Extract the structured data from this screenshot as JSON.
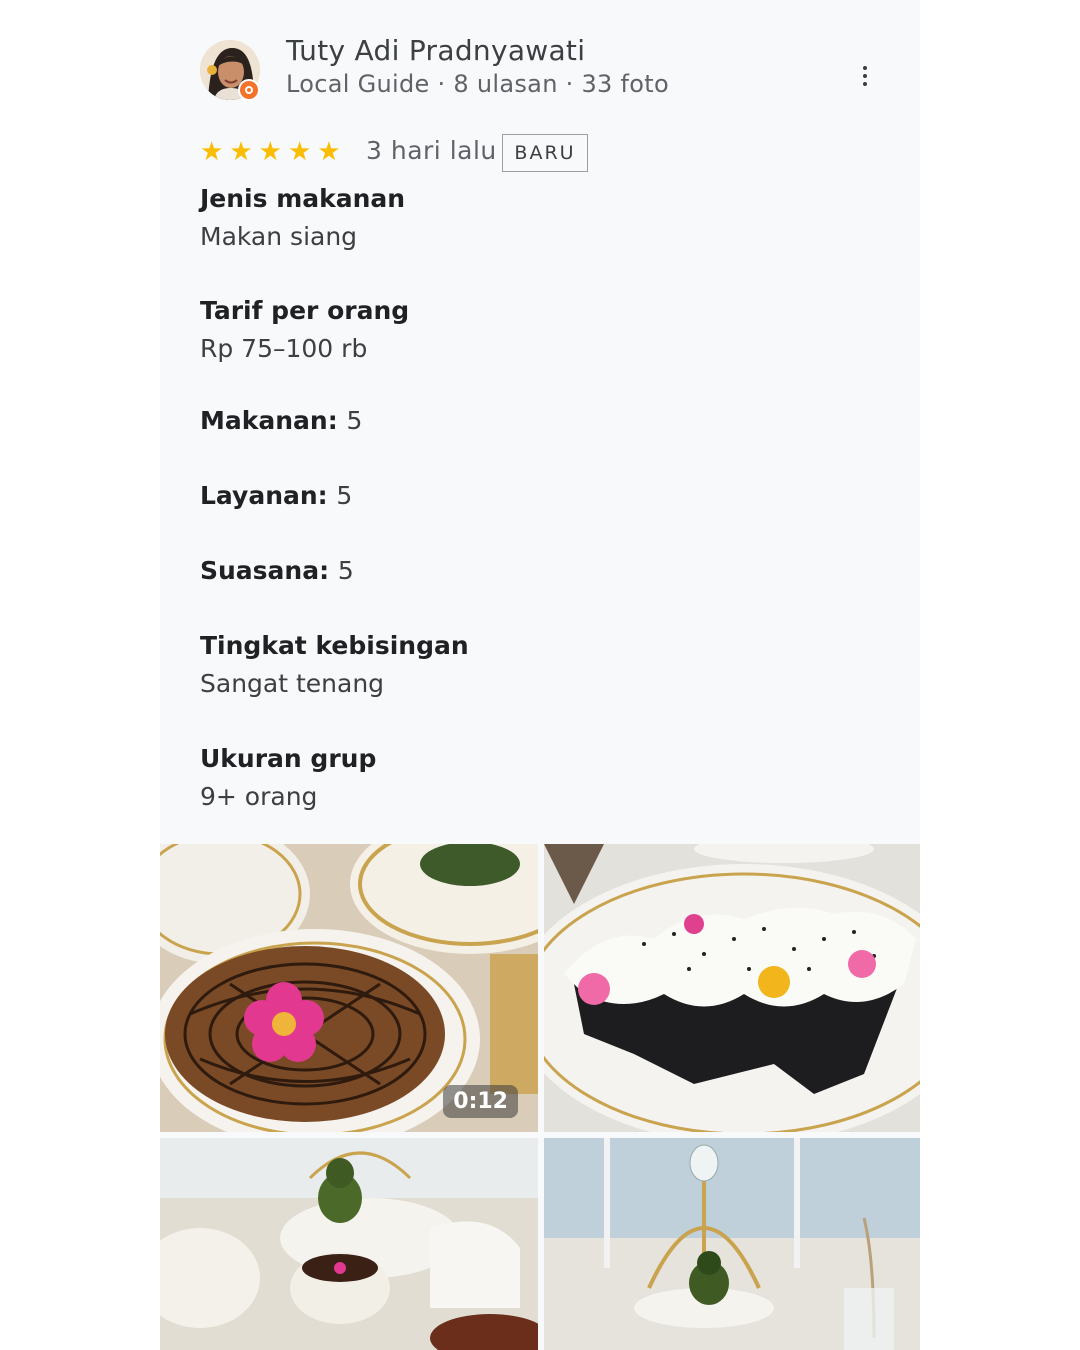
{
  "reviewer": {
    "name": "Tuty Adi Pradnyawati",
    "meta": "Local Guide · 8 ulasan · 33 foto"
  },
  "review": {
    "rating": 5,
    "stars": [
      "★",
      "★",
      "★",
      "★",
      "★"
    ],
    "date": "3 hari lalu",
    "badge": "BARU"
  },
  "attributes": {
    "meal_type_label": "Jenis makanan",
    "meal_type_value": "Makan siang",
    "price_label": "Tarif per orang",
    "price_value": "Rp 75–100 rb",
    "food_label": "Makanan:",
    "food_value": "5",
    "service_label": "Layanan:",
    "service_value": "5",
    "atmosphere_label": "Suasana:",
    "atmosphere_value": "5",
    "noise_label": "Tingkat kebisingan",
    "noise_value": "Sangat tenang",
    "group_label": "Ukuran grup",
    "group_value": "9+ orang"
  },
  "photos": {
    "video_duration": "0:12"
  },
  "colors": {
    "star": "#fbbc04",
    "guide_badge": "#f4732b"
  }
}
